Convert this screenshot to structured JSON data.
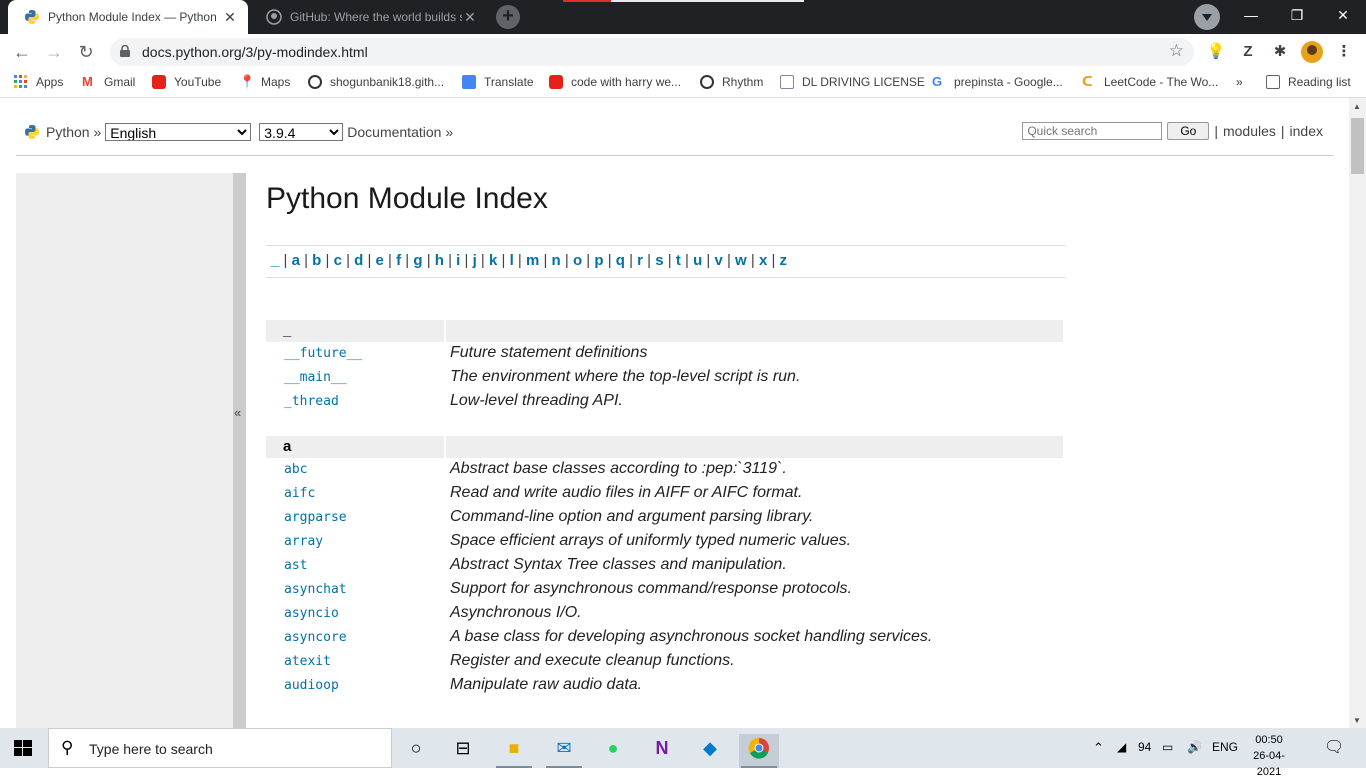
{
  "browser": {
    "tabs": [
      {
        "title": "Python Module Index — Python",
        "active": true
      },
      {
        "title": "GitHub: Where the world builds s",
        "active": false
      }
    ],
    "url": "docs.python.org/3/py-modindex.html",
    "bookmarks": [
      "Apps",
      "Gmail",
      "YouTube",
      "Maps",
      "shogunbanik18.gith...",
      "Translate",
      "code with harry we...",
      "Rhythm",
      "DL DRIVING LICENSE",
      "prepinsta - Google...",
      "LeetCode - The Wo..."
    ],
    "more": "»",
    "reading_list": "Reading list"
  },
  "related": {
    "python": "Python »",
    "language": "English",
    "version": "3.9.4",
    "documentation": "Documentation »",
    "quick_search_placeholder": "Quick search",
    "go": "Go",
    "sep": "|",
    "modules": "modules",
    "index": "index"
  },
  "sidebar_toggle": "«",
  "page": {
    "title": "Python Module Index",
    "letters": [
      "_",
      "a",
      "b",
      "c",
      "d",
      "e",
      "f",
      "g",
      "h",
      "i",
      "j",
      "k",
      "l",
      "m",
      "n",
      "o",
      "p",
      "q",
      "r",
      "s",
      "t",
      "u",
      "v",
      "w",
      "x",
      "z"
    ],
    "groups": [
      {
        "key": "_",
        "modules": [
          {
            "name": "__future__",
            "desc": "Future statement definitions"
          },
          {
            "name": "__main__",
            "desc": "The environment where the top-level script is run."
          },
          {
            "name": "_thread",
            "desc": "Low-level threading API."
          }
        ]
      },
      {
        "key": "a",
        "modules": [
          {
            "name": "abc",
            "desc": "Abstract base classes according to :pep:`3119`."
          },
          {
            "name": "aifc",
            "desc": "Read and write audio files in AIFF or AIFC format."
          },
          {
            "name": "argparse",
            "desc": "Command-line option and argument parsing library."
          },
          {
            "name": "array",
            "desc": "Space efficient arrays of uniformly typed numeric values."
          },
          {
            "name": "ast",
            "desc": "Abstract Syntax Tree classes and manipulation."
          },
          {
            "name": "asynchat",
            "desc": "Support for asynchronous command/response protocols."
          },
          {
            "name": "asyncio",
            "desc": "Asynchronous I/O."
          },
          {
            "name": "asyncore",
            "desc": "A base class for developing asynchronous socket handling services."
          },
          {
            "name": "atexit",
            "desc": "Register and execute cleanup functions."
          },
          {
            "name": "audioop",
            "desc": "Manipulate raw audio data."
          }
        ]
      }
    ]
  },
  "taskbar": {
    "search_placeholder": "Type here to search",
    "battery": "94",
    "lang": "ENG",
    "time": "00:50",
    "date": "26-04-2021"
  }
}
